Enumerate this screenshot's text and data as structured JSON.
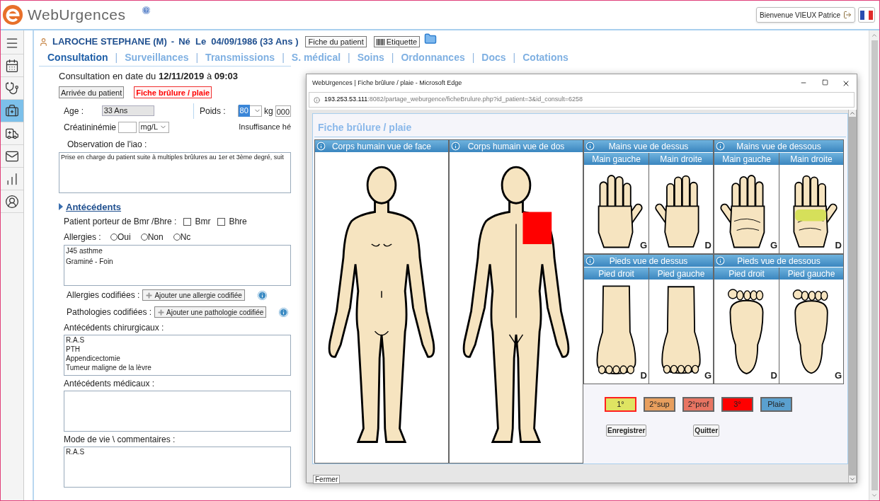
{
  "header": {
    "logo": "WebUrgences",
    "welcome": "Bienvenue VIEUX Patrice"
  },
  "sidebar": [
    {
      "kind": "menu",
      "selected": false
    },
    {
      "kind": "calendar",
      "selected": false
    },
    {
      "kind": "doctor",
      "selected": false
    },
    {
      "kind": "medkit",
      "selected": true
    },
    {
      "kind": "ambulance",
      "selected": false
    },
    {
      "kind": "mail",
      "selected": false
    },
    {
      "kind": "chart",
      "selected": false
    },
    {
      "kind": "user",
      "selected": false
    }
  ],
  "patient": {
    "name": "LAROCHE STEPHANE (M)",
    "separator": "-",
    "birth": "Né  Le  04/09/1986 (33 Ans )",
    "buttons": [
      {
        "label": "Fiche du patient",
        "kind": "plain"
      },
      {
        "label": "Etiquette",
        "kind": "barcode"
      }
    ]
  },
  "tabs": [
    {
      "label": "Consultation",
      "selected": true
    },
    {
      "label": "Surveillances",
      "selected": false,
      "separator": "|"
    },
    {
      "label": "Transmissions",
      "selected": false,
      "separator": "|"
    },
    {
      "label": "S. médical",
      "selected": false,
      "separator": "|"
    },
    {
      "label": "Soins",
      "selected": false,
      "separator": "|"
    },
    {
      "label": "Ordonnances",
      "selected": false,
      "separator": "|"
    },
    {
      "label": "Docs",
      "selected": false,
      "separator": "|"
    },
    {
      "label": "Cotations",
      "selected": false,
      "separator": "|"
    }
  ],
  "consultation": {
    "title": "Consultation en date du **12/11/2019** à **09:03**",
    "actions": [
      {
        "label": "Arrivée du patient",
        "kind": "normal"
      },
      {
        "label": "Fiche brûlure / plaie",
        "kind": "alert"
      }
    ],
    "age": {
      "label": "Age :",
      "value": "33 Ans"
    },
    "weight": {
      "label": "Poids :",
      "value": "80",
      "unit": "kg",
      "extra": "000"
    },
    "creatinine": {
      "label": "Créatininémie",
      "unit": "mg/L"
    },
    "insufficiency": "Insuffisance hé",
    "observation": {
      "label": "Observation de l'iao :",
      "value": "Prise en charge du patient suite à multiples brûlures au 1er et 3ème degré, suit"
    }
  },
  "antecedents": {
    "title": "Antécédents",
    "expanded": true,
    "carrier": {
      "label": "Patient porteur de Bmr /Bhre :",
      "options": [
        {
          "label": "Bmr",
          "checked": false
        },
        {
          "label": "Bhre",
          "checked": false
        }
      ]
    },
    "allergies": {
      "label": "Allergies :",
      "options": [
        {
          "label": "Oui",
          "selected": false
        },
        {
          "label": "Non",
          "selected": false
        },
        {
          "label": "Nc",
          "selected": false
        }
      ],
      "value": "J45 asthme\nGraminé - Foin"
    },
    "coded": [
      {
        "label": "Allergies codifiées :",
        "button": "Ajouter une allergie codifiée"
      },
      {
        "label": "Pathologies codifiées :",
        "button": "Ajouter une pathologie codifiée"
      }
    ],
    "areas": [
      {
        "label": "Antécédents chirurgicaux :",
        "value": "R.A.S\nPTH\nAppendicectomie\nTumeur maligne de la lèvre"
      },
      {
        "label": "Antécédents médicaux :"
      },
      {
        "label": "Mode de vie \\ commentaires :",
        "value": "R.A.S"
      }
    ]
  },
  "popup": {
    "title": "WebUrgences | Fiche brûlure / plaie - Microsoft Edge",
    "url_host": "193.253.53.111",
    "url_path": ":8082/partage_weburgence/ficheBrulure.php?id_patient=3&id_consult=6258",
    "heading": "Fiche brûlure / plaie",
    "bodies": [
      {
        "title": "Corps humain vue de face",
        "kind": "front"
      },
      {
        "title": "Corps humain vue de dos",
        "kind": "back",
        "burn": {
          "color": "#ff0000"
        }
      }
    ],
    "extremities": [
      {
        "title": "Mains vue de dessus",
        "kind": "hand",
        "items": [
          {
            "label": "Main gauche",
            "side": "G",
            "kind": "top"
          },
          {
            "label": "Main droite",
            "side": "D",
            "kind": "top"
          }
        ]
      },
      {
        "title": "Mains vue de dessous",
        "kind": "hand",
        "items": [
          {
            "label": "Main gauche",
            "side": "G",
            "kind": "bottom"
          },
          {
            "label": "Main droite",
            "side": "D",
            "kind": "bottom",
            "burn": {
              "color": "#d6e05a"
            }
          }
        ]
      },
      {
        "title": "Pieds vue de dessus",
        "kind": "foot",
        "items": [
          {
            "label": "Pied droit",
            "side": "D",
            "kind": "top"
          },
          {
            "label": "Pied gauche",
            "side": "G",
            "kind": "top"
          }
        ]
      },
      {
        "title": "Pieds vue de dessous",
        "kind": "foot",
        "items": [
          {
            "label": "Pied droit",
            "side": "D",
            "kind": "bottom"
          },
          {
            "label": "Pied gauche",
            "side": "G",
            "kind": "bottom"
          }
        ]
      }
    ],
    "legend": [
      {
        "label": "1°",
        "color": "#dfe462",
        "selected": true
      },
      {
        "label": "2°sup",
        "color": "#e89f5e",
        "selected": false
      },
      {
        "label": "2°prof",
        "color": "#e87462",
        "selected": false
      },
      {
        "label": "3°",
        "color": "#ff0000",
        "selected": false
      },
      {
        "label": "Plaie",
        "color": "#5aa0cf",
        "selected": false
      }
    ],
    "actions": [
      "Enregistrer",
      "Quitter"
    ],
    "close": "Fermer"
  }
}
